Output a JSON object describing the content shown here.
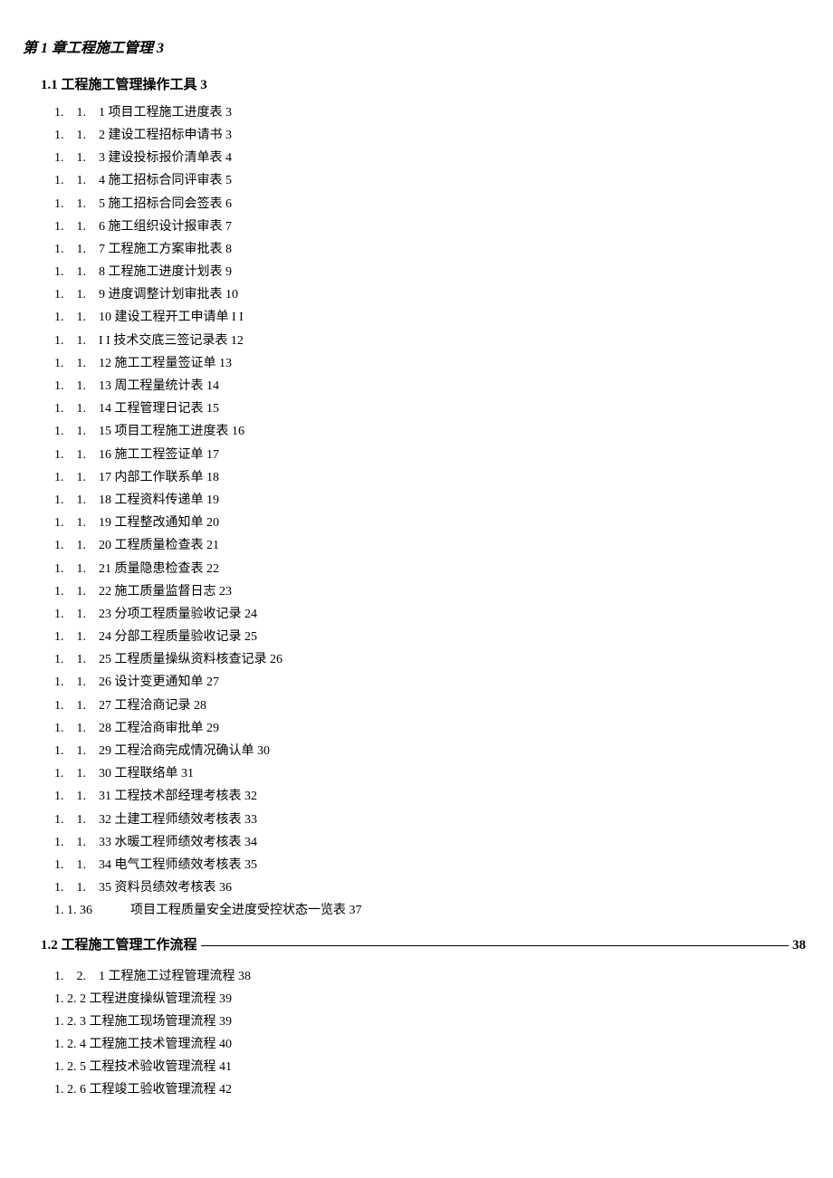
{
  "chapter": {
    "title": "第 1 章工程施工管理 3"
  },
  "section1": {
    "title": "1.1 工程施工管理操作工具 3",
    "items": [
      {
        "prefix": "1.　1.　1 ",
        "text": "项目工程施工进度表 3"
      },
      {
        "prefix": "1.　1.　2 ",
        "text": "建设工程招标申请书 3"
      },
      {
        "prefix": "1.　1.　3 ",
        "text": "建设投标报价清单表 4"
      },
      {
        "prefix": "1.　1.　4 ",
        "text": "施工招标合同评审表 5"
      },
      {
        "prefix": "1.　1.　5 ",
        "text": "施工招标合同会签表 6"
      },
      {
        "prefix": "1.　1.　6 ",
        "text": "施工组织设计报审表 7"
      },
      {
        "prefix": "1.　1.　7 ",
        "text": "工程施工方案审批表 8"
      },
      {
        "prefix": "1.　1.　8 ",
        "text": " 工程施工进度计划表 9"
      },
      {
        "prefix": "1.　1.　9 ",
        "text": " 进度调整计划审批表 10"
      },
      {
        "prefix": "1.　1.　10 ",
        "text": "建设工程开工申请单 I I"
      },
      {
        "prefix": "1.　1.　I I ",
        "text": " 技术交底三签记录表 12"
      },
      {
        "prefix": "1.　1.　12 ",
        "text": "施工工程量签证单 13"
      },
      {
        "prefix": "1.　1.　13 ",
        "text": "周工程量统计表 14"
      },
      {
        "prefix": "1.　1.　14 ",
        "text": "工程管理日记表 15"
      },
      {
        "prefix": "1.　1.　15 ",
        "text": "项目工程施工进度表 16"
      },
      {
        "prefix": "1.　1.　16 ",
        "text": "施工工程签证单 17"
      },
      {
        "prefix": "1.　1.　17 ",
        "text": "内部工作联系单 18"
      },
      {
        "prefix": "1.　1.　18 ",
        "text": "工程资料传递单 19"
      },
      {
        "prefix": "1.　1.　19 ",
        "text": "工程整改通知单 20"
      },
      {
        "prefix": "1.　1.　20 ",
        "text": "工程质量检查表 21"
      },
      {
        "prefix": "1.　1.　21 ",
        "text": "质量隐患检查表 22"
      },
      {
        "prefix": "1.　1.　22 ",
        "text": "施工质量监督日志 23"
      },
      {
        "prefix": "1.　1.　23 ",
        "text": "分项工程质量验收记录 24"
      },
      {
        "prefix": "1.　1.　24 ",
        "text": "分部工程质量验收记录 25"
      },
      {
        "prefix": "1.　1.　25 ",
        "text": "工程质量操纵资料核查记录 26"
      },
      {
        "prefix": "1.　1.　26 ",
        "text": "设计变更通知单 27"
      },
      {
        "prefix": "1.　1.　27 ",
        "text": "工程洽商记录 28"
      },
      {
        "prefix": "1.　1.　28 ",
        "text": "工程洽商审批单 29"
      },
      {
        "prefix": "1.　1.　29 ",
        "text": "工程洽商完成情况确认单 30"
      },
      {
        "prefix": "1.　1.　30 ",
        "text": "工程联络单 31"
      },
      {
        "prefix": "1.　1.　31 ",
        "text": "工程技术部经理考核表 32"
      },
      {
        "prefix": "1.　1.　32 ",
        "text": "土建工程师绩效考核表 33"
      },
      {
        "prefix": "1.　1.　33 ",
        "text": "水暖工程师绩效考核表 34"
      },
      {
        "prefix": "1.　1.　34 ",
        "text": "电气工程师绩效考核表 35"
      },
      {
        "prefix": "1.　1.　35 ",
        "text": "资料员绩效考核表 36"
      },
      {
        "prefix": "1. 1. 36　　　",
        "text": "项目工程质量安全进度受控状态一览表 37"
      }
    ]
  },
  "section2": {
    "title": "1.2 工程施工管理工作流程",
    "page": "38",
    "items": [
      {
        "prefix": "1.　2.　1 ",
        "text": "工程施工过程管理流程 38"
      },
      {
        "prefix": "1. 2. 2 ",
        "text": "工程进度操纵管理流程 39"
      },
      {
        "prefix": "1. 2. 3 ",
        "text": "工程施工现场管理流程 39"
      },
      {
        "prefix": "1. 2. 4 ",
        "text": "工程施工技术管理流程 40"
      },
      {
        "prefix": "1. 2. 5 ",
        "text": "工程技术验收管理流程 41"
      },
      {
        "prefix": "1. 2. 6 ",
        "text": "工程竣工验收管理流程 42"
      }
    ]
  }
}
